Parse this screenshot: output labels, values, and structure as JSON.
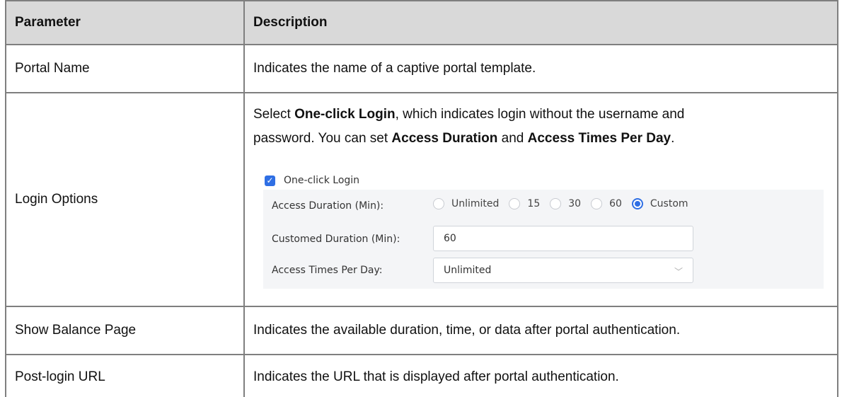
{
  "header": {
    "col1": "Parameter",
    "col2": "Description"
  },
  "rows": [
    {
      "param": "Portal Name",
      "desc": "Indicates the name of a captive portal template."
    },
    {
      "param": "Login Options",
      "desc_parts": [
        "Select ",
        "One-click Login",
        ", which indicates login without the username and",
        "password. You can set ",
        "Access Duration",
        " and ",
        "Access Times Per Day",
        "."
      ]
    },
    {
      "param": "Show Balance Page",
      "desc": "Indicates the available duration, time, or data after portal authentication."
    },
    {
      "param": "Post-login URL",
      "desc": "Indicates the URL that is displayed after portal authentication."
    }
  ],
  "screenshot": {
    "checkbox_label": "One-click Login",
    "checkbox_checked": true,
    "access_duration_label": "Access Duration (Min):",
    "duration_options": [
      "Unlimited",
      "15",
      "30",
      "60",
      "Custom"
    ],
    "duration_selected": "Custom",
    "customed_duration_label": "Customed Duration (Min):",
    "customed_duration_value": "60",
    "access_times_label": "Access Times Per Day:",
    "access_times_value": "Unlimited",
    "accent_color": "#2f6fe4"
  }
}
